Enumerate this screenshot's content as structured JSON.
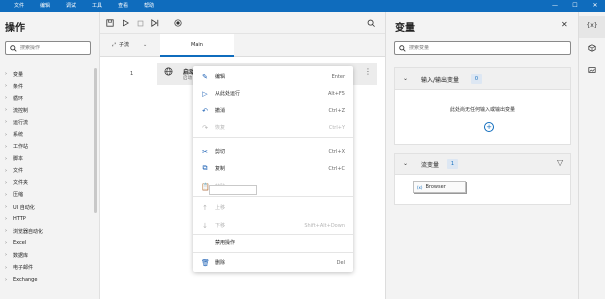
{
  "titlebar": {
    "menu": [
      "文件",
      "编辑",
      "调试",
      "工具",
      "查看",
      "帮助"
    ],
    "minimize": "—",
    "maximize": "☐",
    "close": "✕"
  },
  "actions_panel": {
    "title": "操作",
    "search_placeholder": "搜索操作",
    "categories": [
      "变量",
      "条件",
      "循环",
      "流控制",
      "运行流",
      "系统",
      "工作站",
      "脚本",
      "文件",
      "文件夹",
      "压缩",
      "UI 自动化",
      "HTTP",
      "浏览器自动化",
      "Excel",
      "数据库",
      "电子邮件",
      "Exchange"
    ]
  },
  "toolbar": {
    "icons": [
      "save-icon",
      "play-icon",
      "stop-icon",
      "step-icon",
      "record-icon",
      "search-icon"
    ]
  },
  "subflow": {
    "label": "子流",
    "main_tab": "Main"
  },
  "editor": {
    "line_number": "1",
    "action_title": "启动",
    "action_subtitle": "启动"
  },
  "context_menu": {
    "items": [
      {
        "icon": "edit-icon",
        "label": "编辑",
        "shortcut": "Enter",
        "enabled": true
      },
      {
        "icon": "run-from-here-icon",
        "label": "从此处运行",
        "shortcut": "Alt+F5",
        "enabled": true
      },
      {
        "icon": "undo-icon",
        "label": "撤消",
        "shortcut": "Ctrl+Z",
        "enabled": true
      },
      {
        "icon": "redo-icon",
        "label": "恢复",
        "shortcut": "Ctrl+Y",
        "enabled": false
      },
      {
        "icon": "cut-icon",
        "label": "剪切",
        "shortcut": "Ctrl+X",
        "enabled": true
      },
      {
        "icon": "copy-icon",
        "label": "复制",
        "shortcut": "Ctrl+C",
        "enabled": true
      },
      {
        "icon": "paste-icon",
        "label": "粘贴",
        "shortcut": "",
        "enabled": false
      },
      {
        "icon": "move-up-icon",
        "label": "上移",
        "shortcut": "",
        "enabled": false
      },
      {
        "icon": "move-down-icon",
        "label": "下移",
        "shortcut": "Shift+Alt+Down",
        "enabled": false
      },
      {
        "icon": "",
        "label": "禁用操作",
        "shortcut": "",
        "enabled": true
      },
      {
        "icon": "delete-icon",
        "label": "删除",
        "shortcut": "Del",
        "enabled": true
      }
    ]
  },
  "variables_panel": {
    "title": "变量",
    "search_placeholder": "搜索变量",
    "io_section": {
      "title": "输入/输出变量",
      "count": "0",
      "empty_text": "此处尚无任何输入或输出变量"
    },
    "flow_section": {
      "title": "流变量",
      "count": "1",
      "variable": "Browser",
      "variable_icon": "x-var-icon"
    }
  },
  "rail": {
    "var_label": "{x}"
  }
}
